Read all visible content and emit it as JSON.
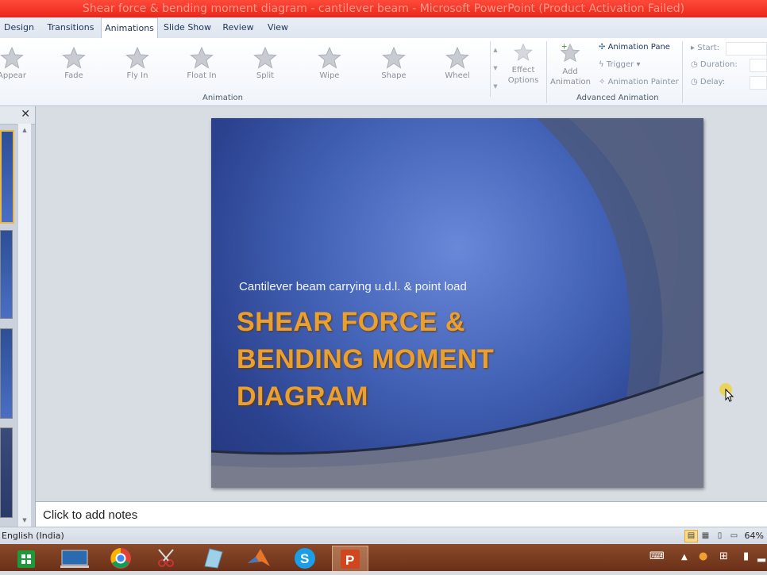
{
  "window": {
    "title": "Shear force & bending moment diagram - cantilever beam - Microsoft PowerPoint (Product Activation Failed)"
  },
  "tabs": [
    {
      "label": "Design"
    },
    {
      "label": "Transitions"
    },
    {
      "label": "Animations",
      "active": true
    },
    {
      "label": "Slide Show"
    },
    {
      "label": "Review"
    },
    {
      "label": "View"
    }
  ],
  "ribbon": {
    "animation_gallery": [
      "Appear",
      "Fade",
      "Fly In",
      "Float In",
      "Split",
      "Wipe",
      "Shape",
      "Wheel"
    ],
    "effect_options": "Effect Options",
    "animation_group_label": "Animation",
    "add_animation": "Add Animation",
    "animation_pane": "Animation Pane",
    "trigger": "Trigger",
    "animation_painter": "Animation Painter",
    "advanced_group_label": "Advanced Animation",
    "start_label": "Start:",
    "duration_label": "Duration:",
    "delay_label": "Delay:"
  },
  "slides_panel": {
    "close_glyph": "✕"
  },
  "slide": {
    "subtitle": "Cantilever beam carrying u.d.l. & point load",
    "title_line1": "SHEAR FORCE &",
    "title_line2": "BENDING MOMENT",
    "title_line3": "DIAGRAM"
  },
  "notes": {
    "placeholder": "Click to add notes"
  },
  "status": {
    "language": "English (India)",
    "zoom": "64%"
  },
  "colors": {
    "titlebar": "#e8261a",
    "title_text": "#e9a030",
    "slide_bg": "#4464b8",
    "taskbar": "#7a3c20"
  },
  "taskbar_icons": [
    "store-icon",
    "laptop-app-icon",
    "chrome-icon",
    "snipping-tool-icon",
    "paper-app-icon",
    "matlab-icon",
    "skype-icon",
    "powerpoint-icon"
  ]
}
